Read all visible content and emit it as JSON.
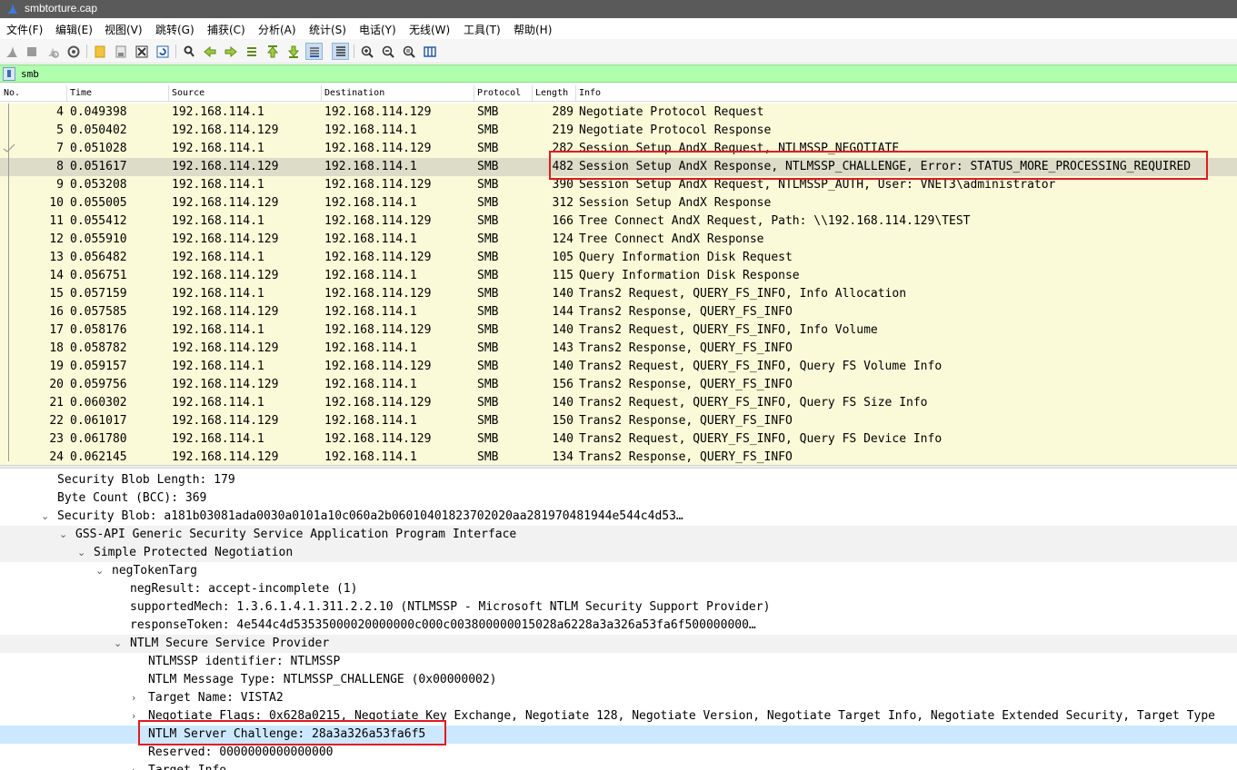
{
  "window": {
    "title": "smbtorture.cap"
  },
  "menu": [
    "文件(F)",
    "编辑(E)",
    "视图(V)",
    "跳转(G)",
    "捕获(C)",
    "分析(A)",
    "统计(S)",
    "电话(Y)",
    "无线(W)",
    "工具(T)",
    "帮助(H)"
  ],
  "toolbar": {
    "icons": [
      "shark-fin-start-icon",
      "stop-icon",
      "restart-icon",
      "options-gear-icon",
      "open-folder-icon",
      "save-file-icon",
      "close-file-icon",
      "reload-icon",
      "find-icon",
      "go-back-icon",
      "go-forward-icon",
      "go-to-packet-icon",
      "first-packet-icon",
      "last-packet-icon",
      "auto-scroll-icon",
      "colorize-icon",
      "zoom-in-icon",
      "zoom-out-icon",
      "normal-size-icon",
      "resize-columns-icon"
    ]
  },
  "filter": {
    "value": "smb"
  },
  "packet_list": {
    "columns": [
      "No.",
      "Time",
      "Source",
      "Destination",
      "Protocol",
      "Length",
      "Info"
    ],
    "rows": [
      {
        "no": "4",
        "time": "0.049398",
        "src": "192.168.114.1",
        "dst": "192.168.114.129",
        "proto": "SMB",
        "len": "289",
        "info": "Negotiate Protocol Request"
      },
      {
        "no": "5",
        "time": "0.050402",
        "src": "192.168.114.129",
        "dst": "192.168.114.1",
        "proto": "SMB",
        "len": "219",
        "info": "Negotiate Protocol Response"
      },
      {
        "no": "7",
        "time": "0.051028",
        "src": "192.168.114.1",
        "dst": "192.168.114.129",
        "proto": "SMB",
        "len": "282",
        "info": "Session Setup AndX Request, NTLMSSP_NEGOTIATE"
      },
      {
        "no": "8",
        "time": "0.051617",
        "src": "192.168.114.129",
        "dst": "192.168.114.1",
        "proto": "SMB",
        "len": "482",
        "info": "Session Setup AndX Response, NTLMSSP_CHALLENGE, Error: STATUS_MORE_PROCESSING_REQUIRED"
      },
      {
        "no": "9",
        "time": "0.053208",
        "src": "192.168.114.1",
        "dst": "192.168.114.129",
        "proto": "SMB",
        "len": "390",
        "info": "Session Setup AndX Request, NTLMSSP_AUTH, User: VNET3\\administrator"
      },
      {
        "no": "10",
        "time": "0.055005",
        "src": "192.168.114.129",
        "dst": "192.168.114.1",
        "proto": "SMB",
        "len": "312",
        "info": "Session Setup AndX Response"
      },
      {
        "no": "11",
        "time": "0.055412",
        "src": "192.168.114.1",
        "dst": "192.168.114.129",
        "proto": "SMB",
        "len": "166",
        "info": "Tree Connect AndX Request, Path: \\\\192.168.114.129\\TEST"
      },
      {
        "no": "12",
        "time": "0.055910",
        "src": "192.168.114.129",
        "dst": "192.168.114.1",
        "proto": "SMB",
        "len": "124",
        "info": "Tree Connect AndX Response"
      },
      {
        "no": "13",
        "time": "0.056482",
        "src": "192.168.114.1",
        "dst": "192.168.114.129",
        "proto": "SMB",
        "len": "105",
        "info": "Query Information Disk Request"
      },
      {
        "no": "14",
        "time": "0.056751",
        "src": "192.168.114.129",
        "dst": "192.168.114.1",
        "proto": "SMB",
        "len": "115",
        "info": "Query Information Disk Response"
      },
      {
        "no": "15",
        "time": "0.057159",
        "src": "192.168.114.1",
        "dst": "192.168.114.129",
        "proto": "SMB",
        "len": "140",
        "info": "Trans2 Request, QUERY_FS_INFO, Info Allocation"
      },
      {
        "no": "16",
        "time": "0.057585",
        "src": "192.168.114.129",
        "dst": "192.168.114.1",
        "proto": "SMB",
        "len": "144",
        "info": "Trans2 Response, QUERY_FS_INFO"
      },
      {
        "no": "17",
        "time": "0.058176",
        "src": "192.168.114.1",
        "dst": "192.168.114.129",
        "proto": "SMB",
        "len": "140",
        "info": "Trans2 Request, QUERY_FS_INFO, Info Volume"
      },
      {
        "no": "18",
        "time": "0.058782",
        "src": "192.168.114.129",
        "dst": "192.168.114.1",
        "proto": "SMB",
        "len": "143",
        "info": "Trans2 Response, QUERY_FS_INFO"
      },
      {
        "no": "19",
        "time": "0.059157",
        "src": "192.168.114.1",
        "dst": "192.168.114.129",
        "proto": "SMB",
        "len": "140",
        "info": "Trans2 Request, QUERY_FS_INFO, Query FS Volume Info"
      },
      {
        "no": "20",
        "time": "0.059756",
        "src": "192.168.114.129",
        "dst": "192.168.114.1",
        "proto": "SMB",
        "len": "156",
        "info": "Trans2 Response, QUERY_FS_INFO"
      },
      {
        "no": "21",
        "time": "0.060302",
        "src": "192.168.114.1",
        "dst": "192.168.114.129",
        "proto": "SMB",
        "len": "140",
        "info": "Trans2 Request, QUERY_FS_INFO, Query FS Size Info"
      },
      {
        "no": "22",
        "time": "0.061017",
        "src": "192.168.114.129",
        "dst": "192.168.114.1",
        "proto": "SMB",
        "len": "150",
        "info": "Trans2 Response, QUERY_FS_INFO"
      },
      {
        "no": "23",
        "time": "0.061780",
        "src": "192.168.114.1",
        "dst": "192.168.114.129",
        "proto": "SMB",
        "len": "140",
        "info": "Trans2 Request, QUERY_FS_INFO, Query FS Device Info"
      },
      {
        "no": "24",
        "time": "0.062145",
        "src": "192.168.114.129",
        "dst": "192.168.114.1",
        "proto": "SMB",
        "len": "134",
        "info": "Trans2 Response, QUERY_FS_INFO"
      }
    ]
  },
  "details": {
    "lines": [
      {
        "text": "Security Blob Length: 179",
        "arrow": ""
      },
      {
        "text": "Byte Count (BCC): 369",
        "arrow": ""
      },
      {
        "text": "Security Blob: a181b03081ada0030a0101a10c060a2b06010401823702020aa281970481944e544c4d53…",
        "arrow": "⌄"
      },
      {
        "text": "GSS-API Generic Security Service Application Program Interface",
        "arrow": "⌄"
      },
      {
        "text": "Simple Protected Negotiation",
        "arrow": "⌄"
      },
      {
        "text": "negTokenTarg",
        "arrow": "⌄"
      },
      {
        "text": "negResult: accept-incomplete (1)",
        "arrow": ""
      },
      {
        "text": "supportedMech: 1.3.6.1.4.1.311.2.2.10 (NTLMSSP - Microsoft NTLM Security Support Provider)",
        "arrow": ""
      },
      {
        "text": "responseToken: 4e544c4d53535000020000000c000c003800000015028a6228a3a326a53fa6f500000000…",
        "arrow": ""
      },
      {
        "text": "NTLM Secure Service Provider",
        "arrow": "⌄"
      },
      {
        "text": "NTLMSSP identifier: NTLMSSP",
        "arrow": ""
      },
      {
        "text": "NTLM Message Type: NTLMSSP_CHALLENGE (0x00000002)",
        "arrow": ""
      },
      {
        "text": "Target Name: VISTA2",
        "arrow": "›"
      },
      {
        "text": "Negotiate Flags: 0x628a0215, Negotiate Key Exchange, Negotiate 128, Negotiate Version, Negotiate Target Info, Negotiate Extended Security, Target Type",
        "arrow": "›"
      },
      {
        "text": "NTLM Server Challenge: 28a3a326a53fa6f5",
        "arrow": ""
      },
      {
        "text": "Reserved: 0000000000000000",
        "arrow": ""
      },
      {
        "text": "Target Info",
        "arrow": "›"
      }
    ]
  },
  "colors": {
    "row_bg": "#fafad8",
    "selected_row_bg": "#dcdcc8",
    "filter_ok": "#afffaf",
    "detail_selected": "#cce8ff",
    "highlight_box": "#e11b22"
  }
}
